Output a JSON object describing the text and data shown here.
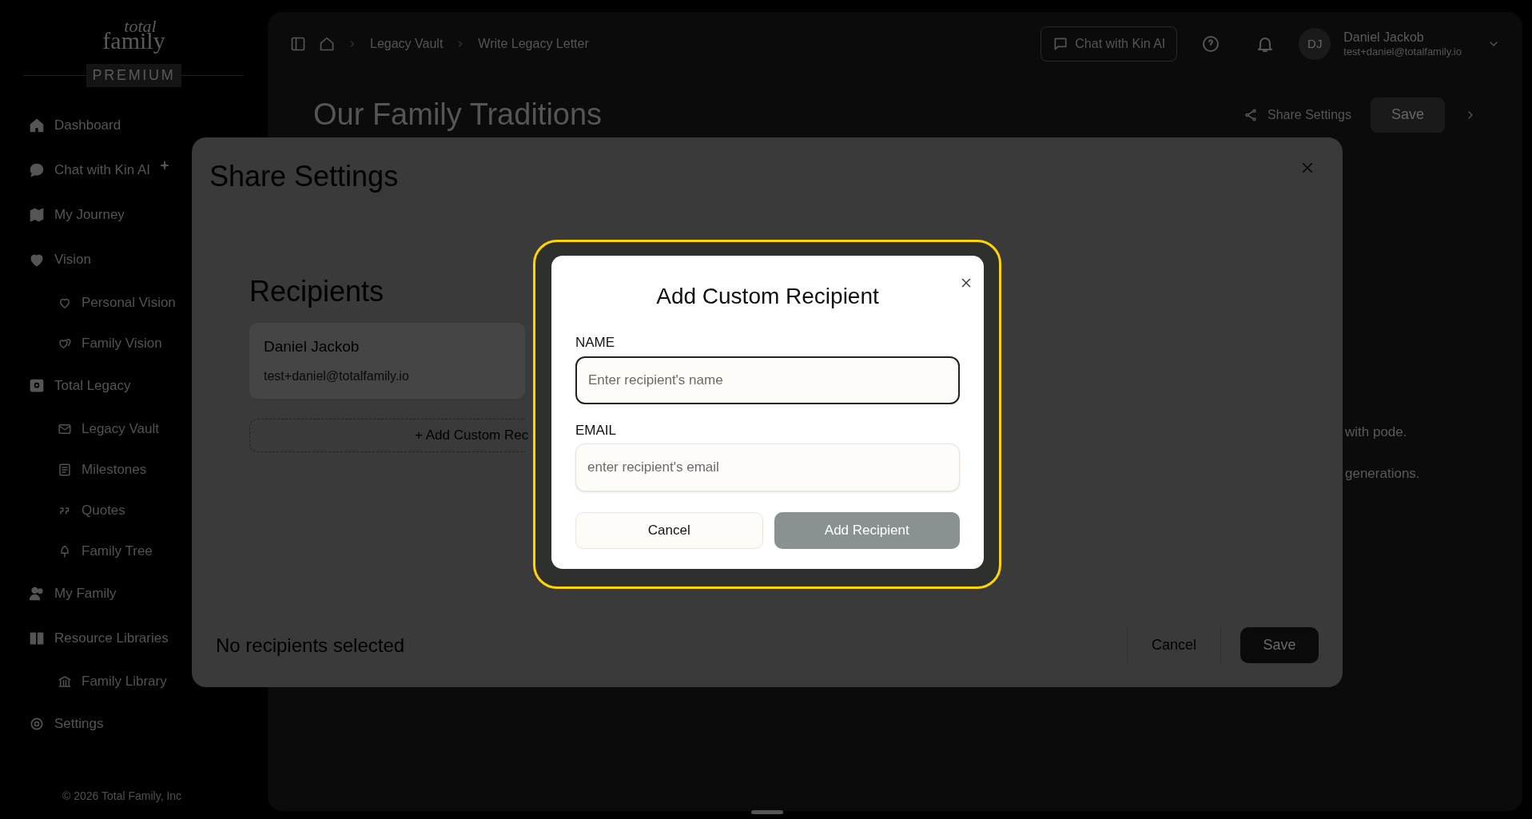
{
  "sidebar": {
    "logo": {
      "top": "total",
      "bottom": "family"
    },
    "badge": "PREMIUM",
    "items": [
      {
        "label": "Dashboard"
      },
      {
        "label": "Chat with Kin AI"
      },
      {
        "label": "My Journey"
      },
      {
        "label": "Vision",
        "children": [
          {
            "label": "Personal Vision"
          },
          {
            "label": "Family Vision"
          }
        ]
      },
      {
        "label": "Total Legacy",
        "children": [
          {
            "label": "Legacy Vault"
          },
          {
            "label": "Milestones"
          },
          {
            "label": "Quotes"
          },
          {
            "label": "Family Tree"
          }
        ]
      },
      {
        "label": "My Family"
      },
      {
        "label": "Resource Libraries",
        "children": [
          {
            "label": "Family Library"
          }
        ]
      },
      {
        "label": "Settings"
      }
    ],
    "footer": "© 2026 Total Family, Inc"
  },
  "header": {
    "breadcrumb": [
      "Legacy Vault",
      "Write Legacy Letter"
    ],
    "chat_button": "Chat with Kin AI",
    "user": {
      "initials": "DJ",
      "name": "Daniel Jackob",
      "email": "test+daniel@totalfamily.io"
    }
  },
  "page": {
    "title": "Our Family Traditions",
    "share_link": "Share Settings",
    "save_button": "Save",
    "body_lines": [
      "with pode.",
      "generations."
    ]
  },
  "share_modal": {
    "title": "Share Settings",
    "recipients_heading": "Recipients",
    "recipients": [
      {
        "name": "Daniel Jackob",
        "email": "test+daniel@totalfamily.io"
      }
    ],
    "add_button": "+ Add Custom Rec",
    "status": "No recipients selected",
    "cancel": "Cancel",
    "save": "Save"
  },
  "dialog": {
    "title": "Add Custom Recipient",
    "fields": [
      {
        "label": "NAME",
        "placeholder": "Enter recipient's name",
        "focused": true
      },
      {
        "label": "EMAIL",
        "placeholder": "enter recipient's email",
        "focused": false
      }
    ],
    "cancel": "Cancel",
    "submit": {
      "label": "Add Recipient",
      "disabled": true
    }
  }
}
